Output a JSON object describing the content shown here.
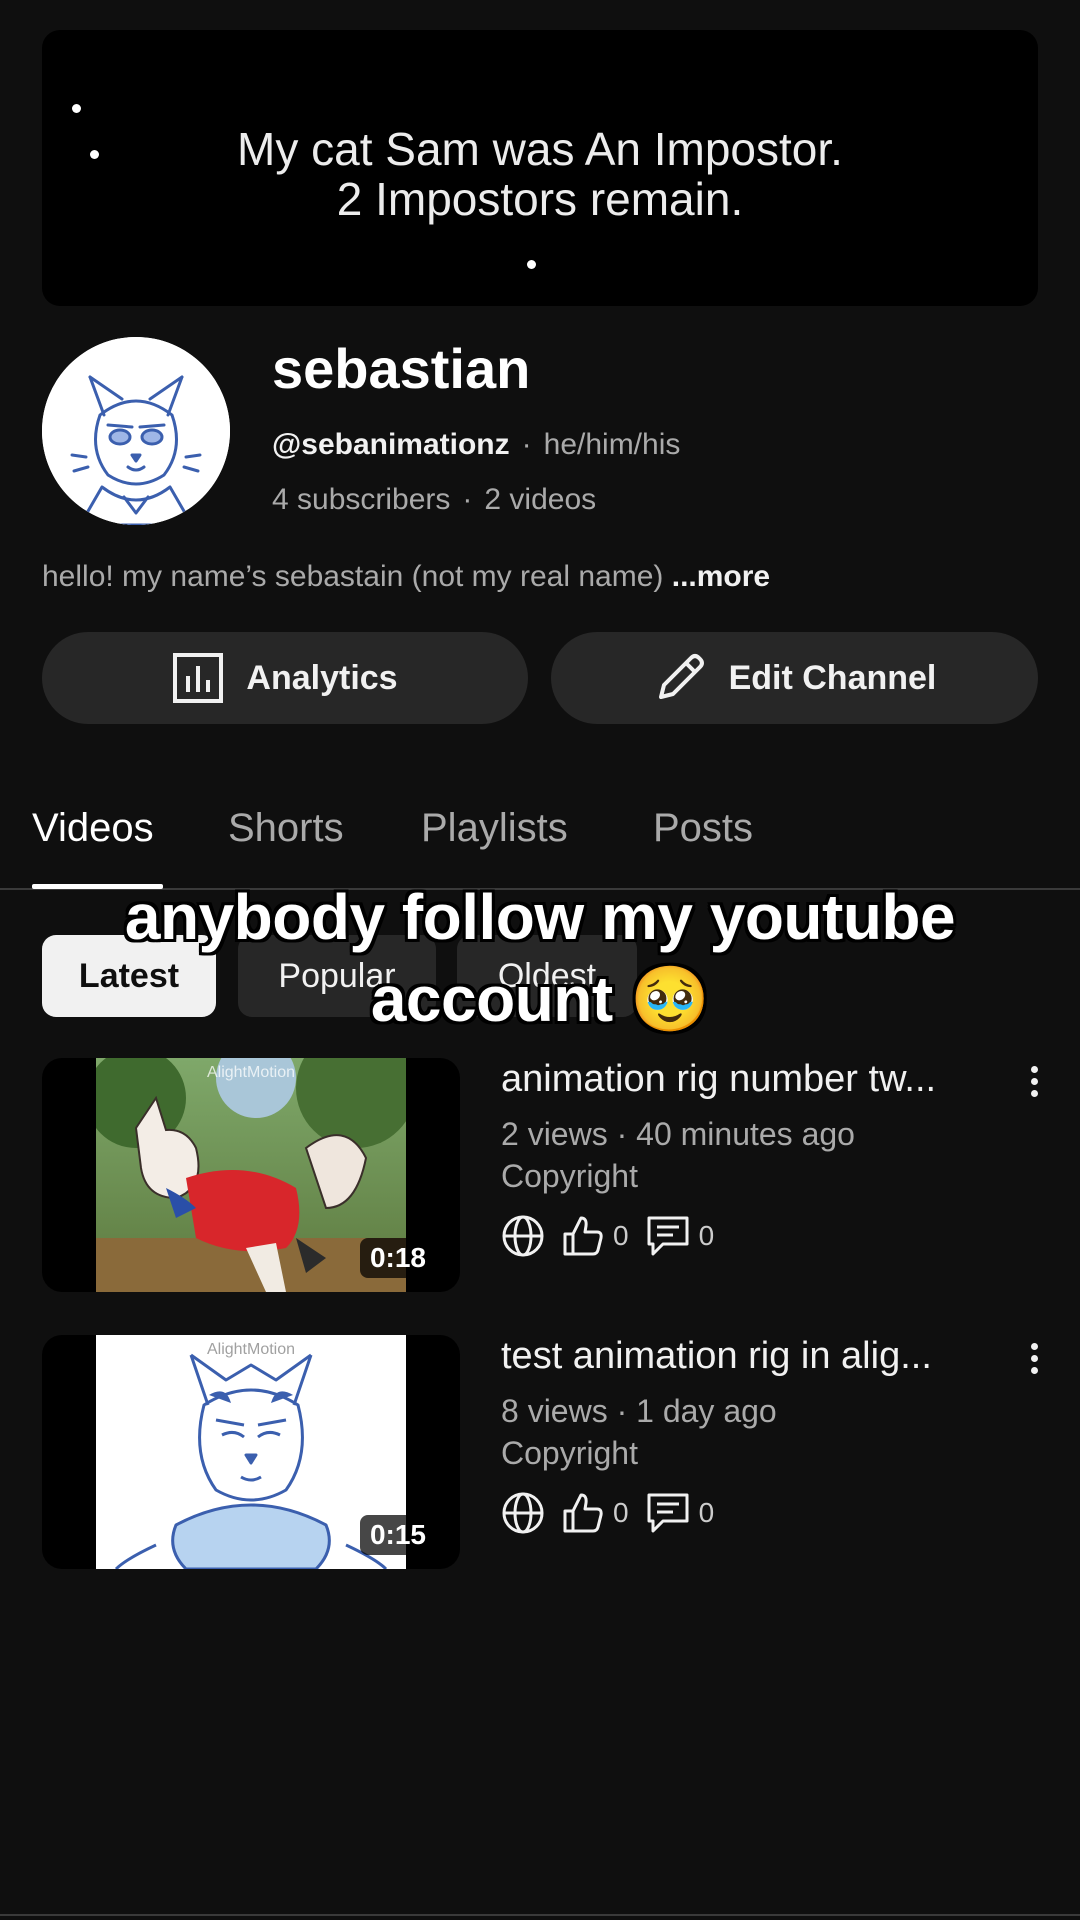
{
  "banner": {
    "line1": "My cat Sam was An Impostor.",
    "line2": "2 Impostors remain."
  },
  "channel": {
    "name": "sebastian",
    "handle": "@sebanimationz",
    "pronouns": "he/him/his",
    "subscribers": "4 subscribers",
    "videos_count": "2 videos",
    "separator": "·",
    "description": "hello! my name’s sebastain (not my real name)",
    "more_label": "...more"
  },
  "actions": {
    "analytics_label": "Analytics",
    "edit_label": "Edit Channel"
  },
  "tabs": {
    "videos": "Videos",
    "shorts": "Shorts",
    "playlists": "Playlists",
    "posts": "Posts"
  },
  "sort_chips": {
    "latest": "Latest",
    "popular": "Popular",
    "oldest": "Oldest"
  },
  "overlay_caption": {
    "line1": "anybody follow my youtube",
    "line2": "account 🥹"
  },
  "videos": [
    {
      "title": "animation rig number tw...",
      "meta": "2 views · 40 minutes ago",
      "copyright": "Copyright",
      "duration": "0:18",
      "likes": "0",
      "comments": "0",
      "watermark": "AlightMotion"
    },
    {
      "title": "test animation rig in alig...",
      "meta": "8 views · 1 day ago",
      "copyright": "Copyright",
      "duration": "0:15",
      "likes": "0",
      "comments": "0",
      "watermark": "AlightMotion"
    }
  ],
  "icons": {
    "analytics": "analytics-icon",
    "edit": "pencil-icon",
    "visibility": "globe-icon",
    "likes": "thumbs-up-icon",
    "comments": "comment-icon",
    "menu": "more-vertical-icon"
  },
  "colors": {
    "background": "#0f0f0f",
    "button": "#272727",
    "chip_active": "#f1f1f1",
    "secondary_text": "#aaaaaa"
  }
}
